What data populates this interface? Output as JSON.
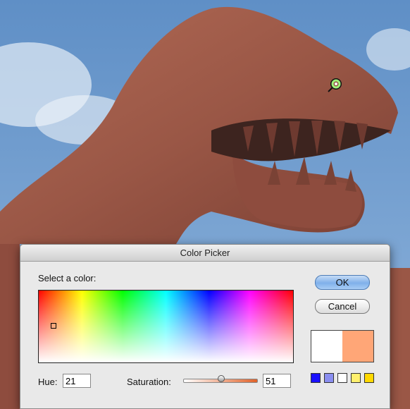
{
  "dialog": {
    "title": "Color Picker",
    "select_label": "Select a color:",
    "ok_label": "OK",
    "cancel_label": "Cancel",
    "hue_label": "Hue:",
    "hue_value": "21",
    "saturation_label": "Saturation:",
    "saturation_value": "51",
    "saturation_level_percent": 51,
    "preview_old_color": "#ffffff",
    "preview_new_color": "#ffa677",
    "swatch_colors": [
      "#1a10ff",
      "#8a8ef0",
      "#ffffff",
      "#fff06e",
      "#ffd800"
    ],
    "slider_gradient": [
      "#ffffff",
      "#e0622a"
    ]
  },
  "cursor": {
    "icon": "eyedropper-icon",
    "ring_color": "#9ef07a"
  }
}
